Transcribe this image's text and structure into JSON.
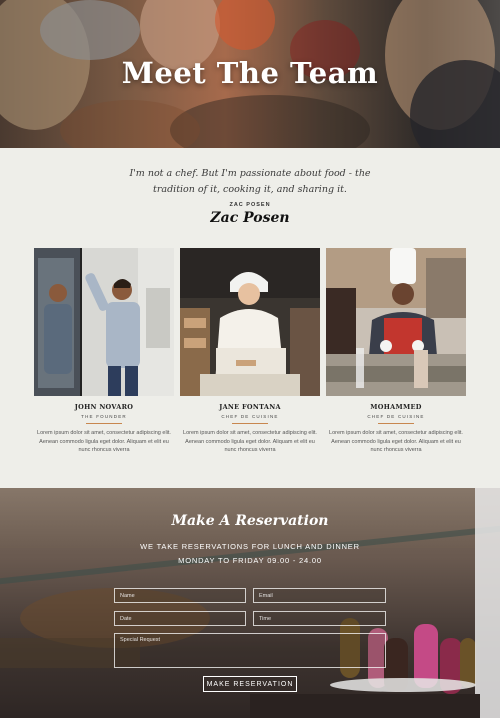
{
  "hero": {
    "title": "Meet The Team"
  },
  "quote": {
    "line1": "I'm not a chef. But I'm passionate about food - the",
    "line2": "tradition of it, cooking it, and sharing it.",
    "author": "ZAC POSEN",
    "signature": "Zac Posen"
  },
  "team": [
    {
      "name": "JOHN NOVARO",
      "role": "THE FOUNDER",
      "desc": "Lorem ipsum dolor sit amet, consectetur adipiscing elit. Aenean commodo ligula eget dolor. Aliquam et elit eu nunc rhoncus viverra"
    },
    {
      "name": "JANE FONTANA",
      "role": "CHEF DE CUISINE",
      "desc": "Lorem ipsum dolor sit amet, consectetur adipiscing elit. Aenean commodo ligula eget dolor. Aliquam et elit eu nunc rhoncus viverra"
    },
    {
      "name": "MOHAMMED",
      "role": "CHEF DE CUISINE",
      "desc": "Lorem ipsum dolor sit amet, consectetur adipiscing elit. Aenean commodo ligula eget dolor. Aliquam et elit eu nunc rhoncus viverra"
    }
  ],
  "reservation": {
    "title": "Make A Reservation",
    "subtitle1": "WE TAKE RESERVATIONS FOR LUNCH AND DINNER",
    "subtitle2": "MONDAY TO FRIDAY 09.00 - 24.00",
    "fields": {
      "name": "Name",
      "email": "Email",
      "date": "Date",
      "time": "Time",
      "request": "Special Request"
    },
    "button": "MAKE RESERVATION"
  },
  "colors": {
    "accent": "#c8874f",
    "background": "#eeeee9"
  }
}
